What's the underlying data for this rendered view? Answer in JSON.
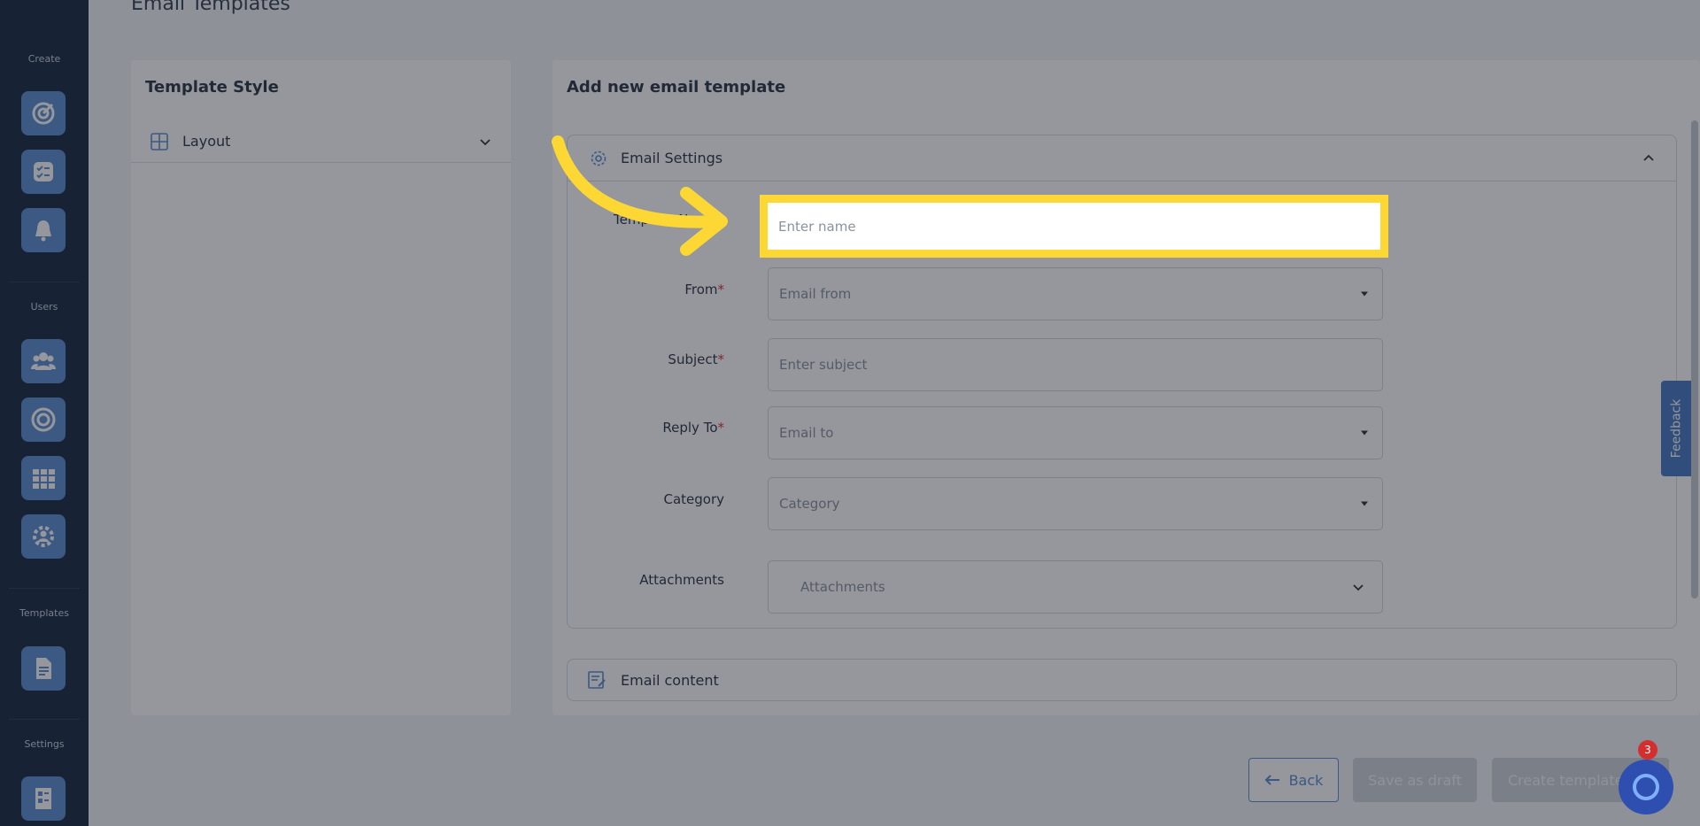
{
  "page": {
    "title": "Email Templates"
  },
  "sidebar": {
    "sections": [
      {
        "label": "Create"
      },
      {
        "label": "Users"
      },
      {
        "label": "Templates"
      },
      {
        "label": "Settings"
      }
    ]
  },
  "template_style": {
    "title": "Template Style",
    "layout_label": "Layout"
  },
  "form": {
    "title": "Add new email template",
    "settings_label": "Email Settings",
    "fields": {
      "template_name": {
        "label": "Template Name",
        "placeholder": "Enter name"
      },
      "from": {
        "label": "From",
        "placeholder": "Email from"
      },
      "subject": {
        "label": "Subject",
        "placeholder": "Enter subject"
      },
      "reply_to": {
        "label": "Reply To",
        "placeholder": "Email to"
      },
      "category": {
        "label": "Category",
        "placeholder": "Category"
      },
      "attachments": {
        "label": "Attachments",
        "placeholder": "Attachments"
      }
    },
    "content_label": "Email content"
  },
  "actions": {
    "back": "Back",
    "save_draft": "Save as draft",
    "create": "Create template"
  },
  "feedback": {
    "label": "Feedback"
  },
  "help": {
    "badge_count": "3"
  },
  "colors": {
    "accent": "#5b8fcf",
    "highlight": "#fdd835",
    "sidebar": "#1d2b44"
  }
}
